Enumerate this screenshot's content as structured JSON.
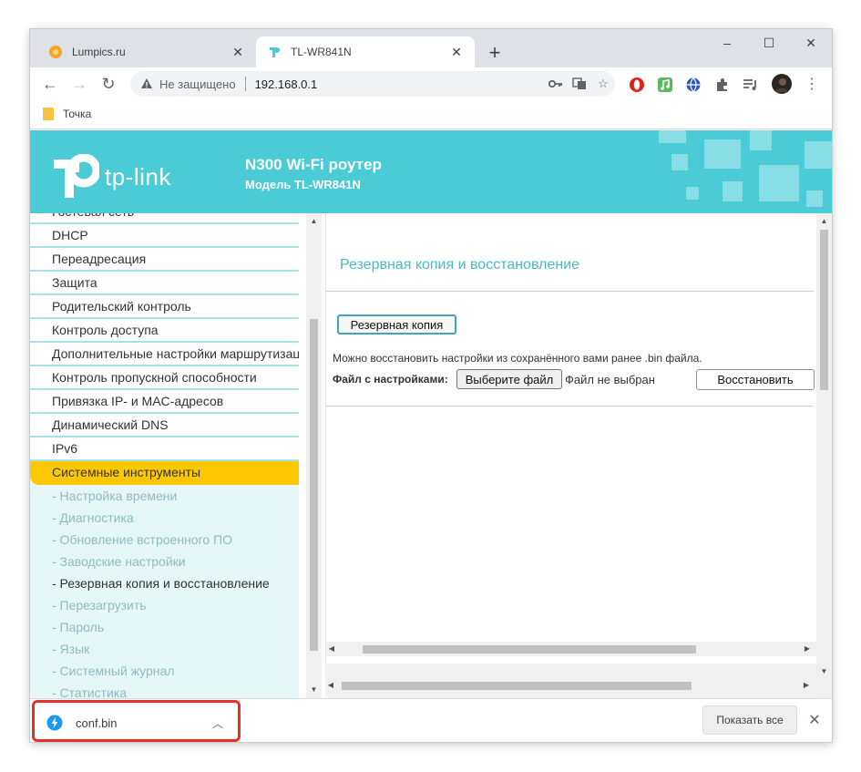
{
  "tabs": [
    {
      "label": "Lumpics.ru",
      "favicon": "orange-circle-icon",
      "active": false
    },
    {
      "label": "TL-WR841N",
      "favicon": "tplink-icon",
      "active": true
    }
  ],
  "window_controls": {
    "minimize": "–",
    "maximize": "☐",
    "close": "✕"
  },
  "address_bar": {
    "security_text": "Не защищено",
    "url": "192.168.0.1"
  },
  "bookmarks": [
    {
      "label": "Точка"
    }
  ],
  "router_header": {
    "logo_text": "tp-link",
    "title": "N300 Wi-Fi роутер",
    "subtitle": "Модель TL-WR841N",
    "accent": "#4acbd6"
  },
  "menu": {
    "items": [
      {
        "label": "Гостевая сеть"
      },
      {
        "label": "DHCP"
      },
      {
        "label": "Переадресация"
      },
      {
        "label": "Защита"
      },
      {
        "label": "Родительский контроль"
      },
      {
        "label": "Контроль доступа"
      },
      {
        "label": "Дополнительные настройки маршрутизации"
      },
      {
        "label": "Контроль пропускной способности"
      },
      {
        "label": "Привязка IP- и MAC-адресов"
      },
      {
        "label": "Динамический DNS"
      },
      {
        "label": "IPv6"
      },
      {
        "label": "Системные инструменты"
      }
    ],
    "sub_items": [
      {
        "label": "- Настройка времени"
      },
      {
        "label": "- Диагностика"
      },
      {
        "label": "- Обновление встроенного ПО"
      },
      {
        "label": "- Заводские настройки"
      },
      {
        "label": "- Резервная копия и восстановление"
      },
      {
        "label": "- Перезагрузить"
      },
      {
        "label": "- Пароль"
      },
      {
        "label": "- Язык"
      },
      {
        "label": "- Системный журнал"
      },
      {
        "label": "- Статистика"
      }
    ]
  },
  "content": {
    "title": "Резервная копия и восстановление",
    "backup_button": "Резервная копия",
    "note": "Можно восстановить настройки из сохранённого вами ранее .bin файла.",
    "file_label": "Файл с настройками:",
    "choose_button": "Выберите файл",
    "no_file": "Файл не выбран",
    "restore_button": "Восстановить"
  },
  "download_bar": {
    "file_name": "conf.bin",
    "show_all": "Показать все"
  }
}
